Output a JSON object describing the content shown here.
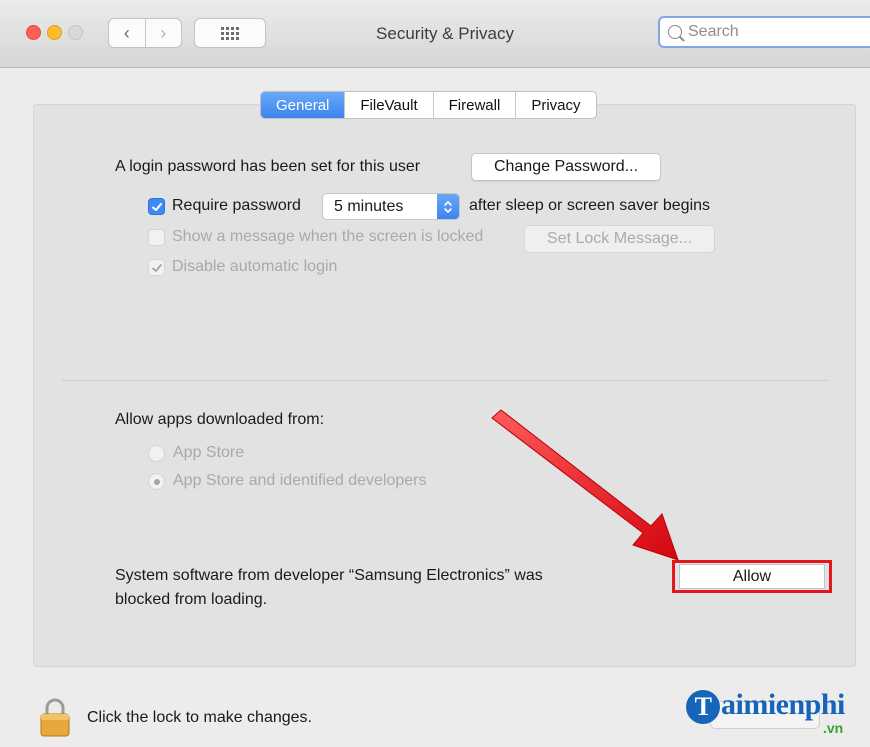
{
  "window": {
    "title": "Security & Privacy",
    "search_placeholder": "Search",
    "nav_back": "‹",
    "nav_forward": "›"
  },
  "tabs": [
    {
      "label": "General",
      "active": true
    },
    {
      "label": "FileVault",
      "active": false
    },
    {
      "label": "Firewall",
      "active": false
    },
    {
      "label": "Privacy",
      "active": false
    }
  ],
  "general": {
    "login_password_text": "A login password has been set for this user",
    "change_password_button": "Change Password...",
    "require_password_label": "Require password",
    "require_password_checked": true,
    "require_password_delay": "5 minutes",
    "require_password_suffix": "after sleep or screen saver begins",
    "show_message_label": "Show a message when the screen is locked",
    "show_message_checked": false,
    "set_lock_message_button": "Set Lock Message...",
    "disable_auto_login_label": "Disable automatic login",
    "disable_auto_login_checked": true
  },
  "apps": {
    "heading": "Allow apps downloaded from:",
    "options": [
      {
        "label": "App Store",
        "selected": false
      },
      {
        "label": "App Store and identified developers",
        "selected": true
      }
    ]
  },
  "blocked": {
    "line1": "System software from developer “Samsung Electronics” was",
    "line2": "blocked from loading.",
    "allow_button": "Allow"
  },
  "footer": {
    "lock_text": "Click the lock to make changes."
  },
  "watermark": {
    "letter": "T",
    "text": "aimienphi",
    "suffix": ".vn"
  },
  "colors": {
    "accent": "#3b84ef",
    "highlight": "#e4151f",
    "watermark_blue": "#1765b8",
    "watermark_green": "#36a234"
  },
  "icons": [
    "close-icon",
    "minimize-icon",
    "zoom-icon",
    "chevron-left-icon",
    "chevron-right-icon",
    "grid-icon",
    "search-icon",
    "checkmark-icon",
    "stepper-icon",
    "lock-icon",
    "arrow-icon"
  ]
}
